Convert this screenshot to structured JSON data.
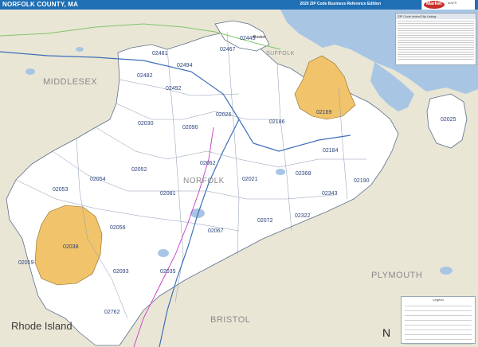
{
  "title": "NORFOLK COUNTY, MA",
  "edition": "2020 ZIP Code Business Reference Edition",
  "logo": {
    "word": "Market",
    "sub": "MAPS"
  },
  "colors": {
    "title_bar": "#1f6fb4",
    "water": "#a8c6e4",
    "county_fill": "#ffffff",
    "highlight_zip": "#f1c46b",
    "outer_land": "#e9e6d6",
    "interstate": "#3c6fb7",
    "route": "#7fc56a",
    "rail": "#c33bc7"
  },
  "county_labels": [
    "MIDDLESEX",
    "SUFFOLK",
    "PLYMOUTH",
    "BRISTOL",
    "NORFOLK"
  ],
  "state_label": "Rhode Island",
  "city_labels": [
    "Boston"
  ],
  "zip_labels": [
    "02481",
    "02494",
    "02467",
    "02445",
    "02482",
    "02492",
    "02030",
    "02090",
    "02026",
    "02186",
    "02169",
    "02025",
    "02184",
    "02190",
    "02052",
    "02062",
    "02053",
    "02054",
    "02081",
    "02021",
    "02368",
    "02343",
    "02056",
    "02072",
    "02322",
    "02038",
    "02067",
    "02019",
    "02093",
    "02035",
    "02762"
  ],
  "index_panel": {
    "header": "ZIP Code Index/City Listing"
  },
  "legend": {
    "header": "Legend"
  },
  "compass": "N"
}
